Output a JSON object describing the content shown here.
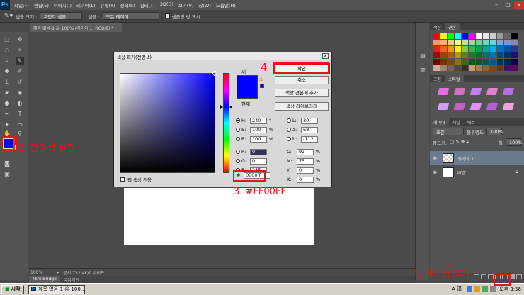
{
  "menu": {
    "items": [
      "파일(F)",
      "편집(E)",
      "이미지(I)",
      "레이어(L)",
      "유형(Y)",
      "선택(S)",
      "필터(T)",
      "3D(D)",
      "보기(V)",
      "창(W)",
      "도움말(H)"
    ]
  },
  "options_bar": {
    "sample_size_label": "샘플 크기 :",
    "sample_size_value": "포인트 샘플",
    "sample_label": "샘플 :",
    "sample_value": "모든 레이어",
    "show_ring_label": "샘플링 링 표시"
  },
  "document": {
    "tab_title": "제목 없음-1 @ 100% (레이어 1, RGB/8) *",
    "zoom": "100%",
    "doc_info": "문서:732.4K/0 바이트"
  },
  "bottom_tabs": [
    "Mini Bridge",
    "타임라인"
  ],
  "color_picker": {
    "title": "색상 피커(전경색)",
    "new_label": "새",
    "current_label": "현재",
    "ok_label": "확인",
    "cancel_label": "취소",
    "add_swatch_label": "색상 견본에 추가",
    "library_label": "색상 라이브러리",
    "web_only_label": "웹 색상 전용",
    "hsb": {
      "H": "240",
      "S": "100",
      "B": "100"
    },
    "rgb": {
      "R": "0",
      "G": "0",
      "B": "255"
    },
    "lab": {
      "L": "30",
      "a": "68",
      "b": "-112"
    },
    "cmyk": {
      "C": "92",
      "M": "75",
      "Y": "0",
      "K": "0"
    },
    "hex": "0000ff",
    "new_color": "#0000ff"
  },
  "panels": {
    "swatch_tabs": [
      "색상",
      "견본"
    ],
    "adjust_tabs": [
      "조정",
      "스타일"
    ],
    "layer_tabs": [
      "레이어",
      "채널",
      "패스"
    ],
    "blend_mode": "표준",
    "opacity_label": "불투명도:",
    "opacity_value": "100%",
    "fill_label": "칠:",
    "fill_value": "100%",
    "lock_label": "잠그기:",
    "layers": [
      {
        "name": "레이어 1",
        "selected": true,
        "transparent": true
      },
      {
        "name": "배경",
        "selected": false,
        "transparent": false
      }
    ]
  },
  "swatch_colors": [
    "#ff0000",
    "#ffff00",
    "#00ff00",
    "#00ffff",
    "#0000ff",
    "#ff00ff",
    "#ffffff",
    "#e6e6e6",
    "#cccccc",
    "#999999",
    "#666666",
    "#000000",
    "#f7977a",
    "#f9ad81",
    "#fdc68a",
    "#fff79a",
    "#c4df9b",
    "#a2d39c",
    "#82ca9d",
    "#7bcdc8",
    "#6ecff6",
    "#7ea7d8",
    "#8493ca",
    "#8882be",
    "#ed1c24",
    "#f26522",
    "#f7941d",
    "#fff200",
    "#8dc73f",
    "#39b54a",
    "#00a651",
    "#00a99d",
    "#00aeef",
    "#0072bc",
    "#0054a6",
    "#2e3192",
    "#9e0b0f",
    "#a0410d",
    "#a36209",
    "#aba000",
    "#598527",
    "#197b30",
    "#007236",
    "#00746b",
    "#0076a3",
    "#004b80",
    "#003471",
    "#1b1464",
    "#790000",
    "#7b2e00",
    "#7d4900",
    "#827b00",
    "#406618",
    "#005e20",
    "#005826",
    "#005952",
    "#005b7f",
    "#003663",
    "#002157",
    "#0d004c",
    "#c7b299",
    "#998675",
    "#736357",
    "#534741",
    "#37302a",
    "#c69c6d",
    "#a67c52",
    "#8c6239",
    "#754c24",
    "#603913",
    "#440e62",
    "#630460"
  ],
  "taskbar": {
    "start_label": "시작",
    "task_label": "제목 없음-1 @ 100...",
    "ime_label": "A 漢",
    "clock": "오후 3:56"
  },
  "annotations": {
    "step1": "1. 레이어 추가",
    "step2": "2. 전경색 설정",
    "step3": "3. #FF00FF",
    "step4": "4"
  },
  "annotation_color": "#e8141b"
}
